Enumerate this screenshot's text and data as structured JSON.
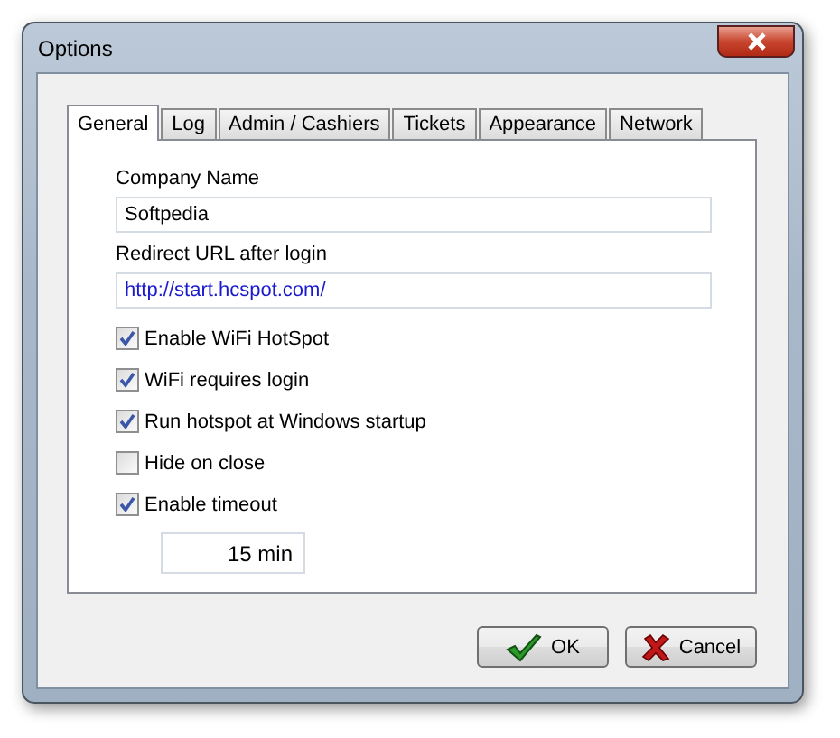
{
  "window": {
    "title": "Options"
  },
  "tabs": [
    {
      "label": "General",
      "selected": true
    },
    {
      "label": "Log",
      "selected": false
    },
    {
      "label": "Admin / Cashiers",
      "selected": false
    },
    {
      "label": "Tickets",
      "selected": false
    },
    {
      "label": "Appearance",
      "selected": false
    },
    {
      "label": "Network",
      "selected": false
    }
  ],
  "fields": [
    {
      "label": "Company Name",
      "value": "Softpedia",
      "kind": "text"
    },
    {
      "label": "Redirect URL after login",
      "value": "http://start.hcspot.com/",
      "kind": "url"
    }
  ],
  "options": [
    {
      "label": "Enable WiFi HotSpot",
      "checked": true
    },
    {
      "label": "WiFi requires login",
      "checked": true
    },
    {
      "label": "Run hotspot at Windows startup",
      "checked": true
    },
    {
      "label": "Hide on close",
      "checked": false
    },
    {
      "label": "Enable timeout",
      "checked": true
    }
  ],
  "timeout": {
    "value": "15 min"
  },
  "buttons": [
    {
      "label": "OK",
      "kind": "ok"
    },
    {
      "label": "Cancel",
      "kind": "cancel"
    }
  ]
}
